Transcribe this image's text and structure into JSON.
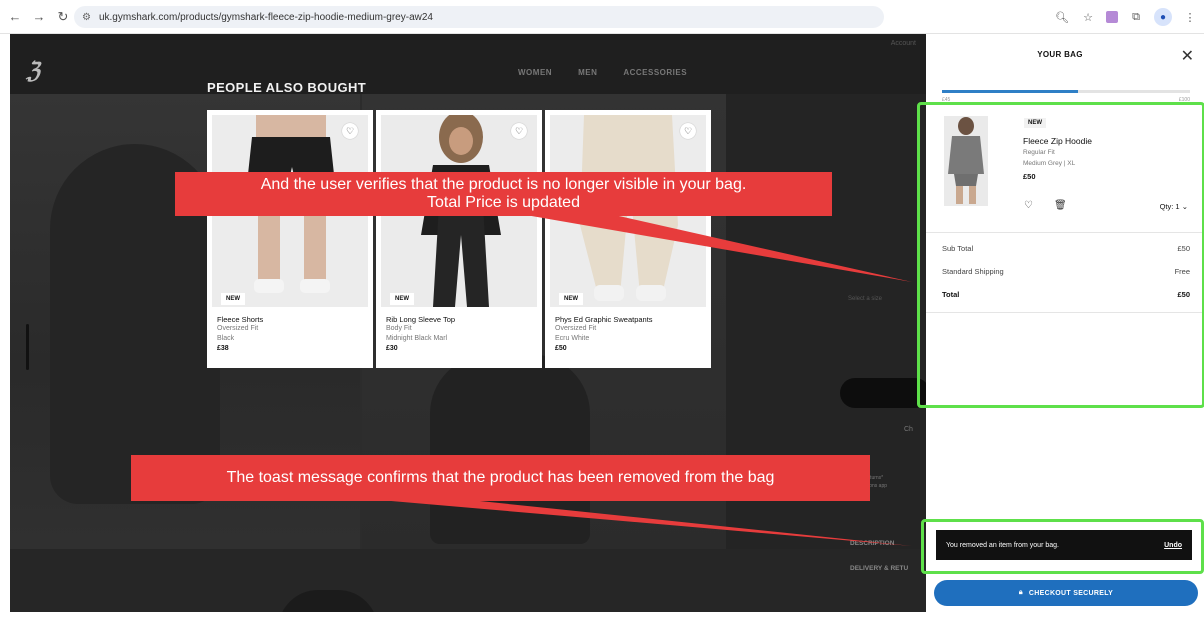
{
  "browser": {
    "url": "uk.gymshark.com/products/gymshark-fleece-zip-hoodie-medium-grey-aw24"
  },
  "site": {
    "nav": [
      "WOMEN",
      "MEN",
      "ACCESSORIES"
    ],
    "account": "Account",
    "pdp": {
      "select_size": "Select a size",
      "checkout_hint": "Ch",
      "free_returns": "Free Returns*",
      "free_returns_sub": "*exclusions app",
      "description": "DESCRIPTION",
      "delivery": "DELIVERY & RETU"
    }
  },
  "people_also_bought": {
    "title": "PEOPLE ALSO BOUGHT",
    "products": [
      {
        "badge": "NEW",
        "name": "Fleece Shorts",
        "fit": "Oversized Fit",
        "color": "Black",
        "price": "£38"
      },
      {
        "badge": "NEW",
        "name": "Rib Long Sleeve Top",
        "fit": "Body Fit",
        "color": "Midnight Black Marl",
        "price": "£30"
      },
      {
        "badge": "NEW",
        "name": "Phys Ed Graphic Sweatpants",
        "fit": "Oversized Fit",
        "color": "Ecru White",
        "price": "£50"
      }
    ]
  },
  "bag": {
    "title": "YOUR BAG",
    "progress": 0.55,
    "progress_left": "£45",
    "progress_right": "£100",
    "item": {
      "badge": "NEW",
      "name": "Fleece Zip Hoodie",
      "fit": "Regular Fit",
      "color": "Medium Grey | XL",
      "price": "£50",
      "qty": "Qty: 1"
    },
    "summary": {
      "subtotal_label": "Sub Total",
      "subtotal_value": "£50",
      "shipping_label": "Standard Shipping",
      "shipping_value": "Free",
      "total_label": "Total",
      "total_value": "£50"
    },
    "toast": {
      "message": "You removed an item from your bag.",
      "undo": "Undo"
    },
    "checkout_label": "CHECKOUT SECURELY"
  },
  "annotations": {
    "callout_top_line1": "And the user verifies that the product is no longer visible in your bag.",
    "callout_top_line2": "Total Price is updated",
    "callout_bottom": "The toast message confirms that the product has been removed from the bag"
  },
  "colors": {
    "highlight": "#5ee04a",
    "callout": "#e73c3c",
    "checkout": "#1f6fbe"
  }
}
